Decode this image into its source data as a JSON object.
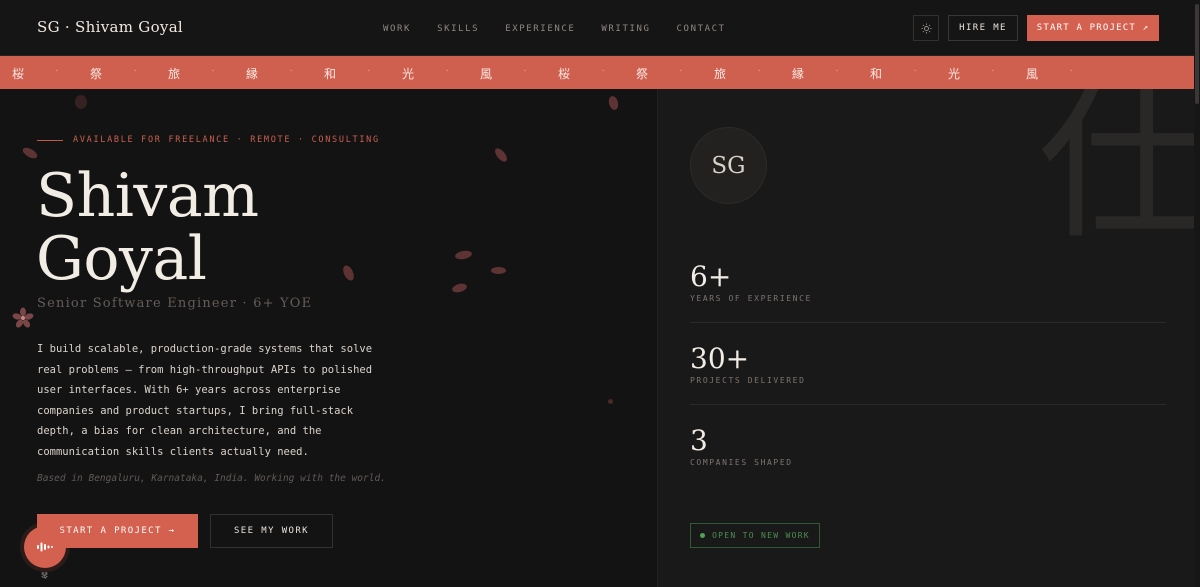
{
  "nav": {
    "logo": "SG · Shivam Goyal",
    "links": [
      "WORK",
      "SKILLS",
      "EXPERIENCE",
      "WRITING",
      "CONTACT"
    ],
    "theme_icon": "sun-icon",
    "hire_label": "HIRE ME",
    "start_label": "START A PROJECT ↗"
  },
  "marquee": {
    "items": [
      "桜",
      "祭",
      "旅",
      "縁",
      "和",
      "光",
      "風",
      "桜",
      "祭",
      "旅",
      "縁",
      "和",
      "光",
      "風"
    ],
    "separator": "·"
  },
  "hero": {
    "availability": "AVAILABLE FOR FREELANCE · REMOTE · CONSULTING",
    "name_line1": "Shivam",
    "name_line2": "Goyal",
    "role": "Senior Software Engineer · 6+ YOE",
    "bio_lines": [
      "I build scalable, production-grade systems that solve",
      "real problems — from high-throughput APIs to polished",
      "user interfaces. With 6+ years across enterprise",
      "companies and product startups, I bring full-stack",
      "depth, a bias for clean architecture, and the",
      "communication skills clients actually need."
    ],
    "based": "Based in Bengaluru, Karnataka, India. Working with the world.",
    "cta_primary": "START A PROJECT →",
    "cta_secondary": "SEE MY WORK"
  },
  "fab": {
    "icon": "audio-wave-icon",
    "label": "琴"
  },
  "panel": {
    "bg_kanji": "仕",
    "avatar": "SG",
    "stats": [
      {
        "value": "6+",
        "label": "YEARS OF EXPERIENCE"
      },
      {
        "value": "30+",
        "label": "PROJECTS DELIVERED"
      },
      {
        "value": "3",
        "label": "COMPANIES SHAPED"
      }
    ],
    "status": "OPEN TO NEW WORK"
  },
  "colors": {
    "accent": "#d4614f",
    "background": "#141313",
    "panel": "#1a1919",
    "status_green": "#4c8f52"
  }
}
